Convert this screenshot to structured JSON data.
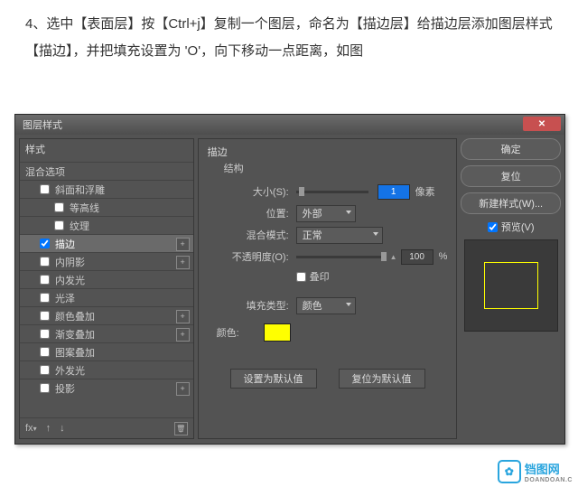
{
  "instruction": "4、选中【表面层】按【Ctrl+j】复制一个图层，命名为【描边层】给描边层添加图层样式【描边】，并把填充设置为 'O'，向下移动一点距离，如图",
  "dialog": {
    "title": "图层样式"
  },
  "left": {
    "header": "样式",
    "items": [
      {
        "label": "混合选项"
      },
      {
        "label": "斜面和浮雕"
      },
      {
        "label": "等高线"
      },
      {
        "label": "纹理"
      },
      {
        "label": "描边",
        "checked": true
      },
      {
        "label": "内阴影"
      },
      {
        "label": "内发光"
      },
      {
        "label": "光泽"
      },
      {
        "label": "颜色叠加"
      },
      {
        "label": "渐变叠加"
      },
      {
        "label": "图案叠加"
      },
      {
        "label": "外发光"
      },
      {
        "label": "投影"
      }
    ]
  },
  "panel": {
    "title": "描边",
    "structure": "结构",
    "size_label": "大小(S):",
    "size_value": "1",
    "size_unit": "像素",
    "position_label": "位置:",
    "position_value": "外部",
    "blend_label": "混合模式:",
    "blend_value": "正常",
    "opacity_label": "不透明度(O):",
    "opacity_value": "100",
    "opacity_unit": "%",
    "overprint": "叠印",
    "filltype_label": "填充类型:",
    "filltype_value": "颜色",
    "color_label": "颜色:",
    "color_hex": "#ffff00",
    "make_default": "设置为默认值",
    "reset_default": "复位为默认值"
  },
  "right": {
    "ok": "确定",
    "cancel": "复位",
    "newstyle": "新建样式(W)...",
    "preview": "预览(V)"
  },
  "watermark": {
    "text": "铛图网",
    "sub": "DOANDOAN.C"
  }
}
